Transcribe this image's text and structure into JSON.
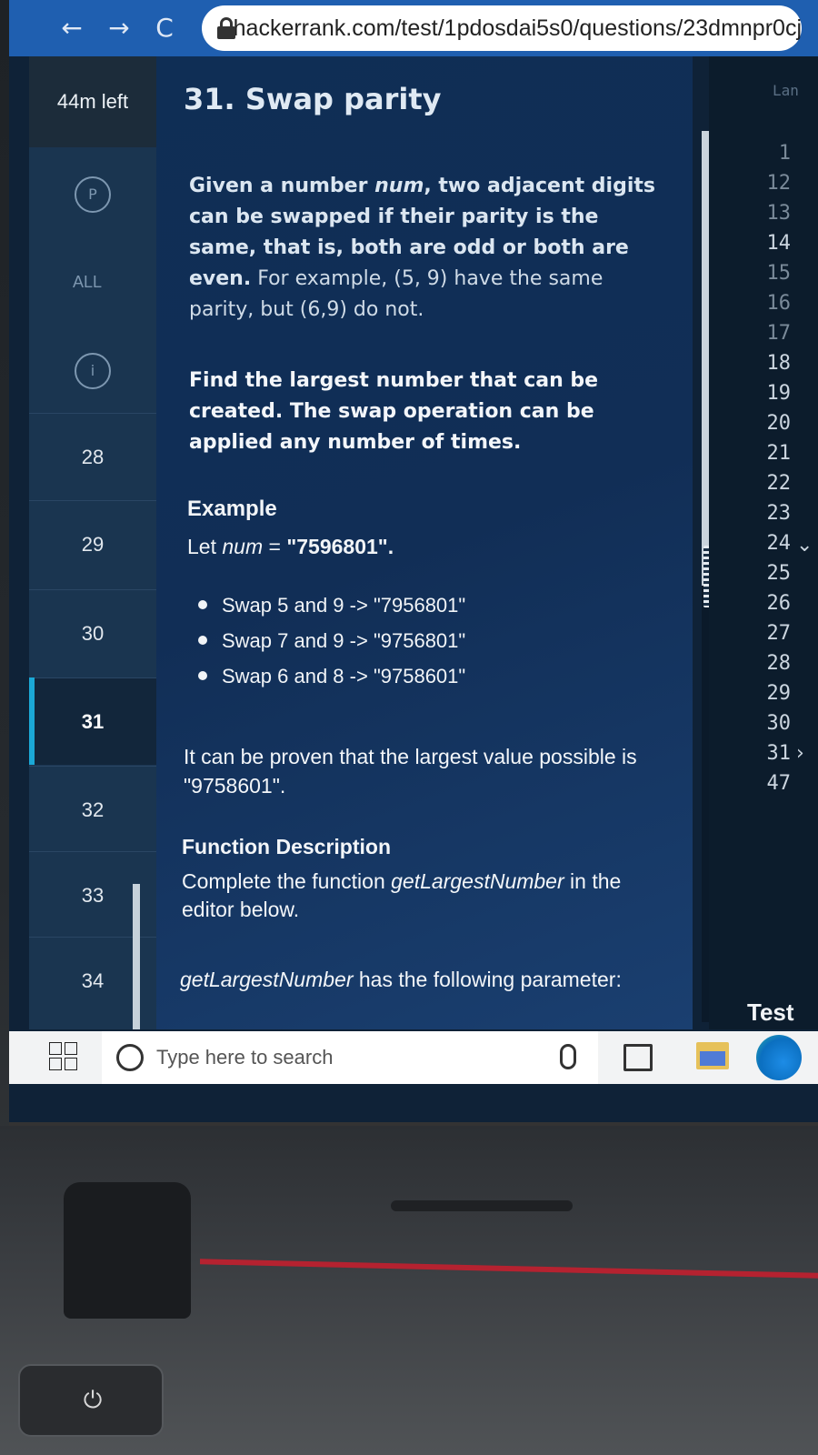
{
  "browser": {
    "url": "hackerrank.com/test/1pdosdai5s0/questions/23dmnpr0cj",
    "back_icon": "←",
    "forward_icon": "→",
    "reload_icon": "C"
  },
  "sidebar": {
    "timer": "44m left",
    "all_label": "ALL",
    "items": [
      {
        "label": "28"
      },
      {
        "label": "29"
      },
      {
        "label": "30"
      },
      {
        "label": "31",
        "active": true
      },
      {
        "label": "32"
      },
      {
        "label": "33"
      },
      {
        "label": "34"
      }
    ]
  },
  "question": {
    "title": "31. Swap parity",
    "para1_part1": "Given a number ",
    "para1_var": "num",
    "para1_part2": ", two adjacent digits can be swapped if their parity is the same, that is, both are odd or both are even.",
    "para1_part3": " For example, (5, 9) have the same parity, but (6,9) do not.",
    "para2": "Find the largest number that can be created. The swap operation can be applied any number of times.",
    "example_heading": "Example",
    "example_let_prefix": "Let ",
    "example_let_var": "num",
    "example_let_eq": " = ",
    "example_let_value": "\"7596801\".",
    "example_steps": [
      "Swap 5 and 9 -> \"7956801\"",
      "Swap 7 and 9 -> \"9756801\"",
      "Swap 6 and 8 -> \"9758601\""
    ],
    "proof": "It can be proven that the largest value possible is \"9758601\".",
    "function_heading": "Function Description",
    "function_body_part1": "Complete the function ",
    "function_name": "getLargestNumber",
    "function_body_part2": " in the editor below.",
    "param_name": "getLargestNumber",
    "param_text": " has the following parameter:"
  },
  "editor": {
    "language_label": "Lan",
    "line_numbers": [
      "1",
      "12",
      "13",
      "14",
      "15",
      "16",
      "17",
      "18",
      "19",
      "20",
      "21",
      "22",
      "23",
      "24",
      "25",
      "26",
      "27",
      "28",
      "29",
      "30",
      "31",
      "47"
    ],
    "test_label": "Test"
  },
  "taskbar": {
    "search_placeholder": "Type here to search"
  },
  "colors": {
    "browser_bar": "#1f5fb0",
    "panel_bg": "#112e56",
    "active_marker": "#1ba8d6"
  }
}
